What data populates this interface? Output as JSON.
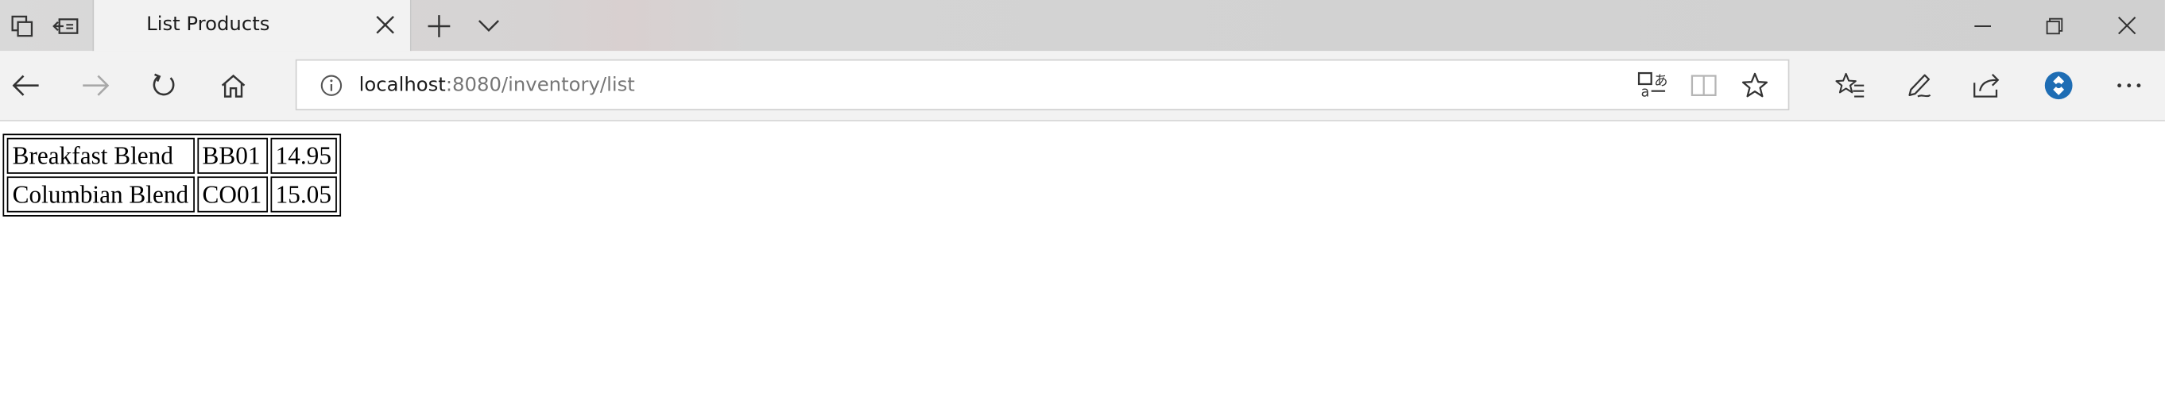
{
  "window": {
    "tab_title": "List Products"
  },
  "address_bar": {
    "host": "localhost",
    "rest": ":8080/inventory/list"
  },
  "icons": {
    "tab_actions": "tab-actions-icon",
    "set_aside_tabs": "set-aside-tabs-icon",
    "tab_close": "close-icon",
    "new_tab": "plus-icon",
    "tab_list": "chevron-down-icon",
    "minimize": "minimize-icon",
    "restore": "restore-icon",
    "close_window": "close-icon",
    "back": "arrow-left-icon",
    "forward": "arrow-right-icon",
    "refresh": "refresh-icon",
    "home": "home-icon",
    "site_info": "info-icon",
    "translate": "translate-icon",
    "reading_view": "book-icon",
    "favorite": "star-icon",
    "favorites_hub": "favorites-icon",
    "notes": "pen-icon",
    "share": "share-icon",
    "extension": "extension-icon",
    "more": "more-icon"
  },
  "colors": {
    "tab_active": "#f2f2f2",
    "extension_blue": "#1e6db4"
  },
  "products_table": {
    "rows": [
      {
        "name": "Breakfast Blend",
        "code": "BB01",
        "price": "14.95"
      },
      {
        "name": "Columbian Blend",
        "code": "CO01",
        "price": "15.05"
      }
    ]
  }
}
